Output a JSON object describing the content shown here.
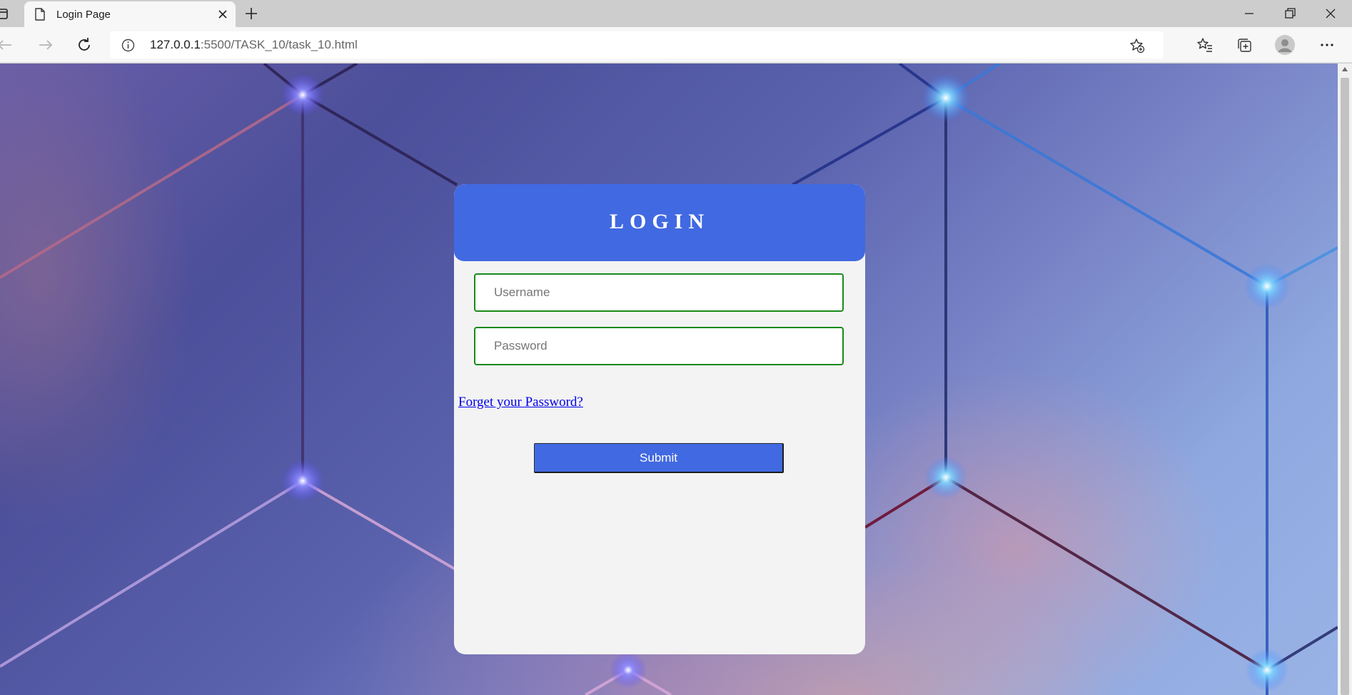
{
  "browser": {
    "tab_title": "Login Page",
    "url_host": "127.0.0.1",
    "url_rest": ":5500/TASK_10/task_10.html"
  },
  "login": {
    "title": "LOGIN",
    "username_placeholder": "Username",
    "password_placeholder": "Password",
    "forgot_label": "Forget your Password?",
    "submit_label": "Submit"
  },
  "colors": {
    "header_blue": "#4169e1",
    "card_bg": "#f3f3f3",
    "input_border": "#1a8a1a",
    "link": "#0000ee"
  }
}
